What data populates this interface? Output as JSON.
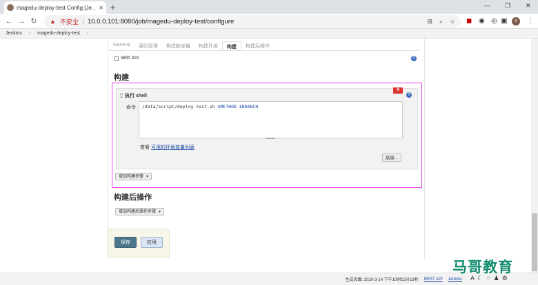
{
  "browser": {
    "tab_title": "magedu-deploy-test Config [Je…",
    "tab_close": "✕",
    "new_tab": "+",
    "win_min": "—",
    "win_max": "❐",
    "win_close": "✕",
    "back": "←",
    "forward": "→",
    "reload": "↻",
    "insecure_label": "不安全",
    "url": "10.0.0.101:8080/job/magedu-deploy-test/configure",
    "avatar": "x",
    "menu": "⋮"
  },
  "breadcrumb": {
    "items": [
      "Jenkins",
      "magedu-deploy-test"
    ],
    "separator": "›"
  },
  "config_tabs": [
    "General",
    "源码管理",
    "构建触发器",
    "构建环境",
    "构建",
    "构建后操作"
  ],
  "with_ant": "With Ant",
  "build_section": {
    "title": "构建",
    "shell_title": "执行 shell",
    "delete_label": "X",
    "command_label": "命令",
    "command_text": "/data/script/deploy-test.sh ",
    "command_vars": "$METHOD $BRANCH",
    "env_prefix": "查看 ",
    "env_link": "可用的环境变量列表",
    "advanced_label": "高级...",
    "add_step_label": "增加构建步骤"
  },
  "post_build": {
    "title": "构建后操作",
    "add_label": "增加构建后操作步骤"
  },
  "buttons": {
    "save": "保存",
    "apply": "应用"
  },
  "help_icon": "?",
  "footer": {
    "generated": "生成页面: 2020-3-14 下午10时22分19秒",
    "rest_api": "REST API",
    "jenkins": "Jenkins"
  },
  "watermark": "马哥教育",
  "colors": {
    "highlight": "#e23ee8",
    "save_button": "#4b758b",
    "delete_button": "#d33333",
    "watermark": "#0f8a6c"
  }
}
